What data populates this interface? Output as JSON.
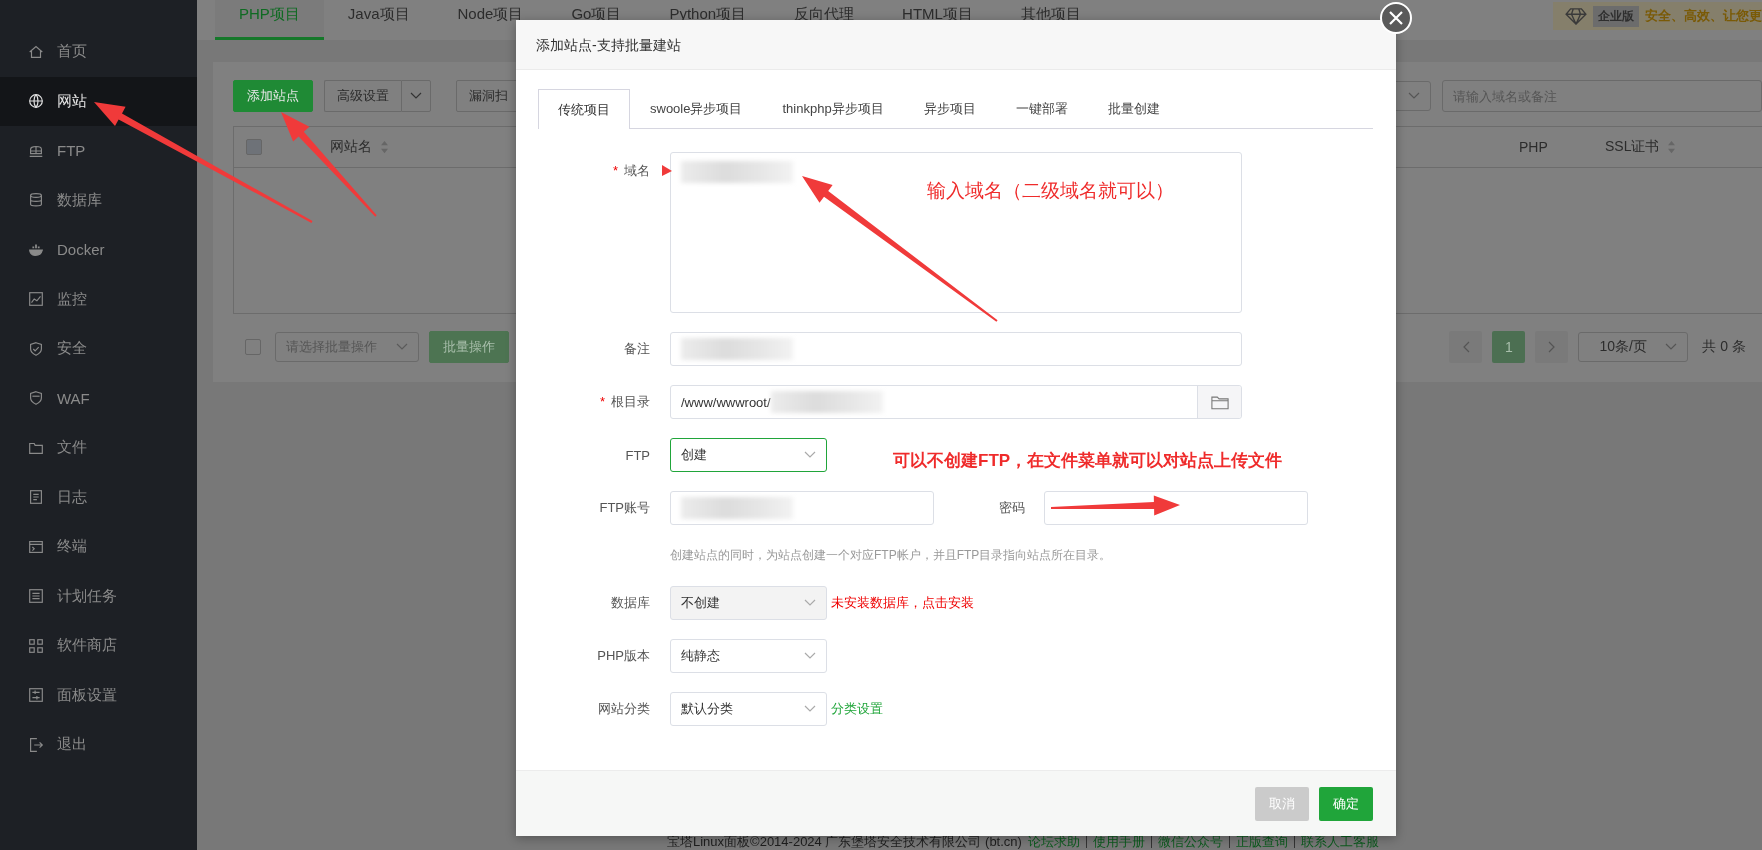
{
  "sidebar": {
    "items": [
      {
        "label": "首页",
        "selected": false
      },
      {
        "label": "网站",
        "selected": true
      },
      {
        "label": "FTP",
        "selected": false
      },
      {
        "label": "数据库",
        "selected": false
      },
      {
        "label": "Docker",
        "selected": false
      },
      {
        "label": "监控",
        "selected": false
      },
      {
        "label": "安全",
        "selected": false
      },
      {
        "label": "WAF",
        "selected": false
      },
      {
        "label": "文件",
        "selected": false
      },
      {
        "label": "日志",
        "selected": false
      },
      {
        "label": "终端",
        "selected": false
      },
      {
        "label": "计划任务",
        "selected": false
      },
      {
        "label": "软件商店",
        "selected": false
      },
      {
        "label": "面板设置",
        "selected": false
      },
      {
        "label": "退出",
        "selected": false
      }
    ]
  },
  "top_tabs": [
    {
      "label": "PHP项目",
      "selected": true
    },
    {
      "label": "Java项目",
      "selected": false
    },
    {
      "label": "Node项目",
      "selected": false
    },
    {
      "label": "Go项目",
      "selected": false
    },
    {
      "label": "Python项目",
      "selected": false
    },
    {
      "label": "反向代理",
      "selected": false
    },
    {
      "label": "HTML项目",
      "selected": false
    },
    {
      "label": "其他项目",
      "selected": false
    }
  ],
  "edition": {
    "badge": "企业版",
    "slogan": "安全、高效、让您更"
  },
  "toolbar": {
    "add_site": "添加站点",
    "advanced": "高级设置",
    "scan": "漏洞扫"
  },
  "search": {
    "placeholder": "请输入域名或备注"
  },
  "table": {
    "select_all": {
      "checked": false
    },
    "columns": [
      {
        "label": "网站名",
        "sortable": true
      },
      {
        "label": "PHP",
        "sortable": false
      },
      {
        "label": "SSL证书",
        "sortable": true
      }
    ]
  },
  "batch": {
    "checked": false,
    "placeholder": "请选择批量操作",
    "button": "批量操作"
  },
  "pagination": {
    "pages": [
      {
        "label": "1",
        "selected": true
      }
    ],
    "page_size": "10条/页",
    "total": "共 0 条"
  },
  "footer": {
    "copyright": "宝塔Linux面板©2014-2024 广东堡塔安全技术有限公司 (bt.cn)",
    "links": [
      "论坛求助",
      "使用手册",
      "微信公众号",
      "正版查询",
      "联系人工客服"
    ]
  },
  "dialog": {
    "title": "添加站点-支持批量建站",
    "tabs": [
      {
        "label": "传统项目",
        "selected": true
      },
      {
        "label": "swoole异步项目",
        "selected": false
      },
      {
        "label": "thinkphp异步项目",
        "selected": false
      },
      {
        "label": "异步项目",
        "selected": false
      },
      {
        "label": "一键部署",
        "selected": false
      },
      {
        "label": "批量创建",
        "selected": false
      }
    ],
    "fields": [
      {
        "kind": "textarea",
        "label": "域名",
        "required_mark": "*"
      },
      {
        "kind": "input",
        "label": "备注"
      },
      {
        "kind": "path",
        "label": "根目录",
        "required_mark": "*",
        "value": "/www/wwwroot/"
      },
      {
        "kind": "select",
        "label": "FTP",
        "value": "创建",
        "focused": true,
        "disabled": false
      },
      {
        "kind": "pair",
        "label": "FTP账号",
        "label2": "密码"
      },
      {
        "kind": "hint",
        "text": "创建站点的同时，为站点创建一个对应FTP帐户，并且FTP目录指向站点所在目录。"
      },
      {
        "kind": "select",
        "label": "数据库",
        "value": "不创建",
        "focused": false,
        "disabled": true,
        "note": {
          "text": "未安装数据库，点击安装",
          "color": "#ef0000"
        }
      },
      {
        "kind": "select",
        "label": "PHP版本",
        "value": "纯静态",
        "focused": false,
        "disabled": false
      },
      {
        "kind": "select",
        "label": "网站分类",
        "value": "默认分类",
        "focused": false,
        "disabled": false,
        "note": {
          "text": "分类设置",
          "color": "#20a53a"
        }
      }
    ],
    "buttons": [
      {
        "label": "取消",
        "kind": "cancel"
      },
      {
        "label": "确定",
        "kind": "confirm"
      }
    ]
  },
  "annotations": [
    "输入域名（二级域名就可以）",
    "可以不创建FTP，在文件菜单就可以对站点上传文件"
  ]
}
